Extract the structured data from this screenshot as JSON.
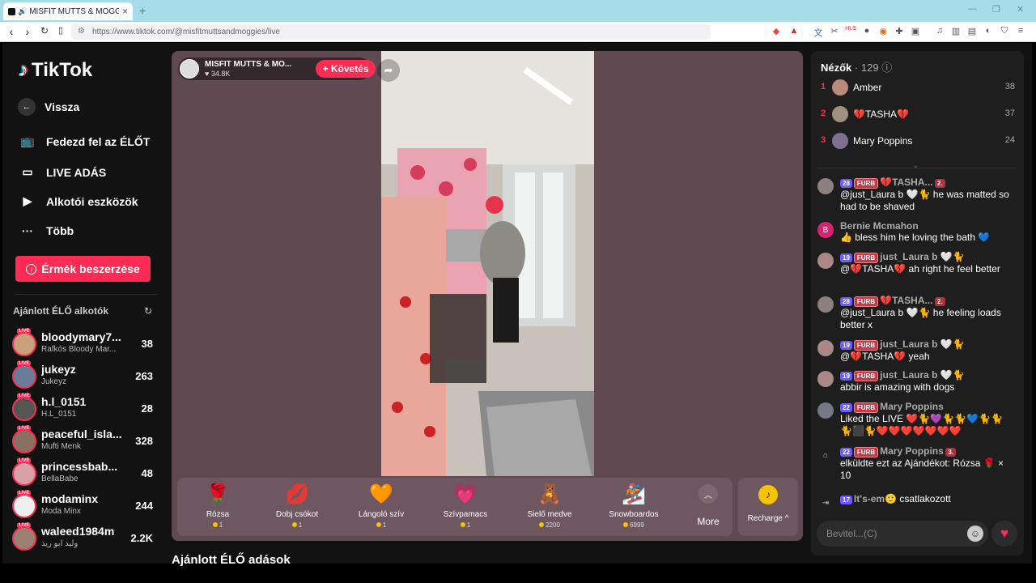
{
  "browser": {
    "tab_title": "MISFIT MUTTS & MOGGIE",
    "url": "https://www.tiktok.com/@misfitmuttsandmoggies/live"
  },
  "sidebar": {
    "logo": "TikTok",
    "back_label": "Vissza",
    "menu": [
      {
        "label": "Fedezd fel az ÉLŐT",
        "icon": "live-tv-icon"
      },
      {
        "label": "LIVE ADÁS",
        "icon": "video-camera-icon"
      },
      {
        "label": "Alkotói eszközök",
        "icon": "creator-tools-icon"
      },
      {
        "label": "Több",
        "icon": "more-dots-icon"
      }
    ],
    "coins_button": "Érmék beszerzése",
    "recommended_header": "Ajánlott ÉLŐ alkotók",
    "creators": [
      {
        "name": "bloodymary7...",
        "sub": "Rafkós Bloody Mar...",
        "count": "38"
      },
      {
        "name": "jukeyz",
        "sub": "Jukeyz",
        "count": "263"
      },
      {
        "name": "h.l_0151",
        "sub": "H.L_0151",
        "count": "28"
      },
      {
        "name": "peaceful_isla...",
        "sub": "Mufti Menk",
        "count": "328"
      },
      {
        "name": "princessbab...",
        "sub": "BellaBabe",
        "count": "48"
      },
      {
        "name": "modaminx",
        "sub": "Moda Minx",
        "count": "244"
      },
      {
        "name": "waleed1984m",
        "sub": "وليد ابو ريد",
        "count": "2.2K"
      }
    ],
    "live_badge": "LIVE"
  },
  "stream": {
    "host_name": "MISFIT MUTTS & MO...",
    "likes": "34.8K",
    "follow_label": "+ Követés",
    "gifts": [
      {
        "name": "Rózsa",
        "price": "1",
        "icon": "🌹"
      },
      {
        "name": "Dobj csókot",
        "price": "1",
        "icon": "💋"
      },
      {
        "name": "Lángoló szív",
        "price": "1",
        "icon": "🧡"
      },
      {
        "name": "Szívpamacs",
        "price": "1",
        "icon": "💗"
      },
      {
        "name": "Sielő medve",
        "price": "2200",
        "icon": "🧸"
      },
      {
        "name": "Snowboardos",
        "price": "6999",
        "icon": "🏂"
      }
    ],
    "more_label": "More",
    "recharge_label": "Recharge ^",
    "section_title": "Ajánlott ÉLŐ adások"
  },
  "viewers": {
    "title": "Nézők",
    "count": "· 129",
    "top": [
      {
        "rank": "1",
        "name": "Amber",
        "score": "38"
      },
      {
        "rank": "2",
        "name": "💔TASHA💔",
        "score": "37"
      },
      {
        "rank": "3",
        "name": "Mary Poppins",
        "score": "24"
      }
    ]
  },
  "chat": [
    {
      "level": "28",
      "fan": "FURB",
      "user": "💔TASHA...",
      "extra": "2.",
      "text": "@just_Laura b 🤍🐈 he was matted so had to be shaved"
    },
    {
      "user": "Bernie Mcmahon",
      "text": "👍 bless him he loving the bath 💙",
      "initial": "B"
    },
    {
      "level": "19",
      "fan": "FURB",
      "user": "just_Laura b 🤍🐈",
      "text": "@💔TASHA💔 ah right he feel better"
    },
    {
      "level": "28",
      "fan": "FURB",
      "user": "💔TASHA...",
      "extra": "2.",
      "text": "@just_Laura b 🤍🐈 he feeling loads better x"
    },
    {
      "level": "19",
      "fan": "FURB",
      "user": "just_Laura b 🤍🐈",
      "text": "@💔TASHA💔 yeah"
    },
    {
      "level": "19",
      "fan": "FURB",
      "user": "just_Laura b 🤍🐈",
      "text": "abbir is amazing with dogs"
    },
    {
      "level": "22",
      "fan": "FURB",
      "user": "Mary Poppins",
      "text": "Liked the LIVE ❤️🐈💜🐈🐈💙🐈🐈 🐈⬛🐈❤️❤️❤️❤️❤️❤️❤️"
    },
    {
      "level": "22",
      "fan": "FURB",
      "user": "Mary Poppins",
      "extra": "3.",
      "text": "elküldte ezt az Ajándékot: Rózsa 🌹 × 10"
    },
    {
      "level": "17",
      "user": "It's-em🙂",
      "text": "csatlakozott"
    }
  ],
  "input": {
    "placeholder": "Bevitel...(C)"
  }
}
